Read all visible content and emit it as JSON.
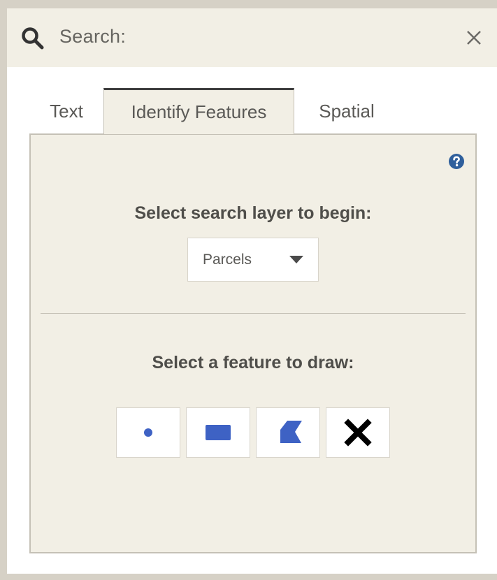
{
  "header": {
    "title": "Search:",
    "search_icon": "search-icon",
    "close_icon": "close-icon"
  },
  "tabs": [
    {
      "label": "Text",
      "active": false
    },
    {
      "label": "Identify Features",
      "active": true
    },
    {
      "label": "Spatial",
      "active": false
    }
  ],
  "panel": {
    "help_icon": "help-icon",
    "layer_prompt": "Select search layer to begin:",
    "layer_select": {
      "value": "Parcels"
    },
    "draw_prompt": "Select a feature to draw:",
    "draw_tools": [
      {
        "icon": "point-icon"
      },
      {
        "icon": "rectangle-icon"
      },
      {
        "icon": "polygon-icon"
      },
      {
        "icon": "clear-icon"
      }
    ]
  },
  "colors": {
    "header_bg": "#f2efe5",
    "panel_bg": "#f2efe5",
    "frame": "#d6d1c6",
    "accent_blue": "#3e62c4",
    "help_blue": "#2f5f9c"
  }
}
